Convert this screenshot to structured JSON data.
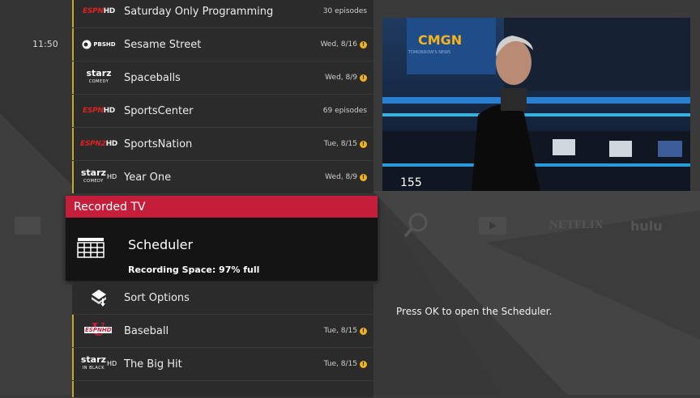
{
  "time": "11:50",
  "guide_rows": [
    {
      "logo": "espn-hd",
      "logo_text": "ESPN",
      "logo_hd": "HD",
      "title": "Saturday Only Programming",
      "meta": "30 episodes",
      "warning": false
    },
    {
      "logo": "pbs-hd",
      "logo_text": "PBS",
      "logo_hd": "HD",
      "title": "Sesame Street",
      "meta": "Wed, 8/16",
      "warning": true
    },
    {
      "logo": "starz-comedy",
      "logo_text": "starz",
      "logo_sub": "COMEDY",
      "title": "Spaceballs",
      "meta": "Wed, 8/9",
      "warning": true
    },
    {
      "logo": "espn-hd",
      "logo_text": "ESPN",
      "logo_hd": "HD",
      "title": "SportsCenter",
      "meta": "69 episodes",
      "warning": false
    },
    {
      "logo": "espn2-hd",
      "logo_text": "ESPN2",
      "logo_hd": "HD",
      "title": "SportsNation",
      "meta": "Tue, 8/15",
      "warning": true
    },
    {
      "logo": "starz-comedy-hd",
      "logo_text": "starz",
      "logo_hd": "HD",
      "logo_sub": "COMEDY",
      "title": "Year One",
      "meta": "Wed, 8/9",
      "warning": true
    }
  ],
  "recorded": {
    "header": "Recorded TV",
    "scheduler_title": "Scheduler",
    "space": "Recording Space: 97% full"
  },
  "lower_rows": [
    {
      "logo": "sort-icon",
      "title": "Sort Options",
      "meta": "",
      "warning": false
    },
    {
      "logo": "espnu-hd",
      "logo_text": "ESPN",
      "logo_hd": "HD",
      "title": "Baseball",
      "meta": "Tue, 8/15",
      "warning": true
    },
    {
      "logo": "starz-inblack-hd",
      "logo_text": "starz",
      "logo_hd": "HD",
      "logo_sub": "IN BLACK",
      "title": "The Big Hit",
      "meta": "Tue, 8/15",
      "warning": true
    }
  ],
  "preview": {
    "channel_number": "155",
    "sign_text": "CMGN",
    "sign_sub": "TOMORROW'S NEWS"
  },
  "nav": {
    "netflix": "NETFLIX",
    "hulu": "hulu"
  },
  "hint": "Press OK to open the Scheduler.",
  "colors": {
    "accent_red": "#c41e3a",
    "row_bg": "#2b2b2b",
    "warning": "#f0b21d",
    "row_border": "#c9a42a"
  }
}
